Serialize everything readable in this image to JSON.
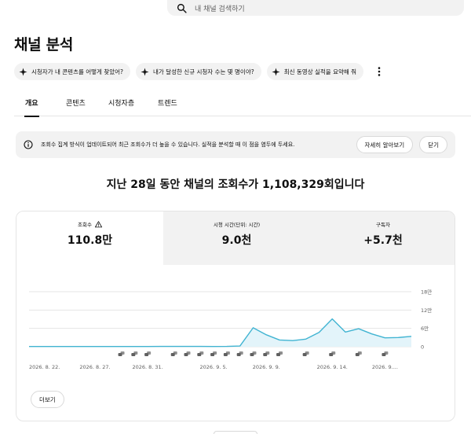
{
  "search": {
    "placeholder": "내 채널 검색하기"
  },
  "page_title": "채널 분석",
  "chips": [
    {
      "label": "시청자가 내 콘텐츠를 어떻게 찾았어?"
    },
    {
      "label": "내가 달성한 신규 시청자 수는 몇 명이야?"
    },
    {
      "label": "최신 동영상 실적을 요약해 줘"
    }
  ],
  "tabs": [
    {
      "label": "개요",
      "active": true
    },
    {
      "label": "콘텐츠",
      "active": false
    },
    {
      "label": "시청자층",
      "active": false
    },
    {
      "label": "트렌드",
      "active": false
    }
  ],
  "notice": {
    "message": "조회수 집계 방식이 업데이트되어 최근 조회수가 더 높을 수 있습니다. 실적을 분석할 때 이 점을 염두에 두세요.",
    "learn_more": "자세히 알아보기",
    "close": "닫기"
  },
  "headline": "지난 28일 동안 채널의 조회수가 1,108,329회입니다",
  "metrics": [
    {
      "label": "조회수",
      "value": "110.8만",
      "warning_icon": "warning-icon"
    },
    {
      "label": "시청 시간(단위: 시간)",
      "value": "9.0천"
    },
    {
      "label": "구독자",
      "value": "+5.7천"
    }
  ],
  "more_button": "더보기",
  "colors": {
    "line": "#41b4d2",
    "fill": "#e3f4fa",
    "grid": "#e5e5e5",
    "text": "#606060"
  },
  "chart_data": {
    "type": "area",
    "series": [
      {
        "values": [
          800,
          800,
          800,
          800,
          800,
          800,
          800,
          800,
          800,
          800,
          1000,
          1000,
          1000,
          1000,
          800,
          1000,
          2400,
          62000,
          39000,
          22000,
          20000,
          25000,
          47000,
          91000,
          48000,
          59000,
          42000,
          29000,
          30000,
          34000
        ]
      }
    ],
    "ylim": [
      0,
      180000
    ],
    "yticks": [
      "18만",
      "12만",
      "6만",
      "0"
    ],
    "ytick_values": [
      180000,
      120000,
      60000,
      0
    ],
    "xticks": [
      "2026. 8. 22.",
      "2026. 8. 27.",
      "2026. 8. 31.",
      "2026. 9. 5.",
      "2026. 9. 9.",
      "2026. 9. 14.",
      "2026. 9...."
    ],
    "xtick_index": [
      0,
      5,
      9,
      14,
      18,
      23,
      27
    ],
    "marker_index": [
      7,
      8,
      9,
      11,
      12,
      13,
      14,
      15,
      16,
      17,
      18,
      19,
      21,
      23,
      25,
      27
    ],
    "marker_icon": "upload-video-icon"
  }
}
